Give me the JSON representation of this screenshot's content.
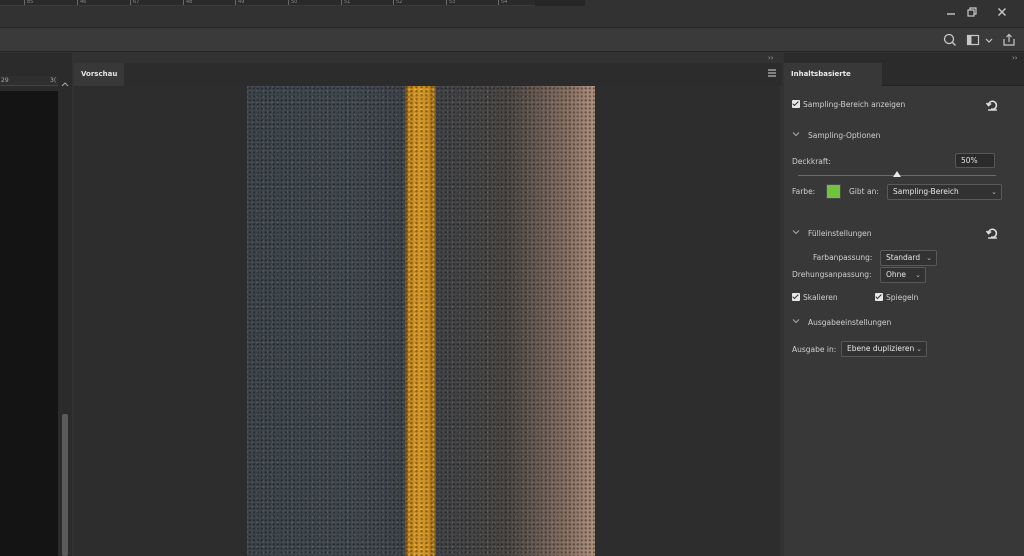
{
  "ruler_top": {
    "ticks": [
      "85",
      "46",
      "67",
      "48",
      "49",
      "50",
      "51",
      "52",
      "53",
      "54"
    ]
  },
  "ruler_left": {
    "a": "29",
    "b": "3("
  },
  "window": {
    "minimize_icon": "minimize-icon",
    "restore_icon": "restore-icon",
    "close_icon": "close-icon"
  },
  "preview": {
    "tab_label": "Vorschau"
  },
  "panel": {
    "title": "Inhaltsbasierte Füllung",
    "show_sampling_label": "Sampling-Bereich anzeigen",
    "show_sampling_checked": true,
    "sampling_options_label": "Sampling-Optionen",
    "opacity_label": "Deckkraft:",
    "opacity_value": "50%",
    "opacity_level": 0.5,
    "color_label": "Farbe:",
    "color_value": "#6fc43c",
    "indicates_label": "Gibt an:",
    "indicates_value": "Sampling-Bereich",
    "fill_settings_label": "Fülleinstellungen",
    "color_adapt_label": "Farbanpassung:",
    "color_adapt_value": "Standard",
    "rotation_adapt_label": "Drehungsanpassung:",
    "rotation_adapt_value": "Ohne",
    "scale_label": "Skalieren",
    "scale_checked": true,
    "mirror_label": "Spiegeln",
    "mirror_checked": true,
    "output_settings_label": "Ausgabeeinstellungen",
    "output_label": "Ausgabe in:",
    "output_value": "Ebene duplizieren"
  }
}
